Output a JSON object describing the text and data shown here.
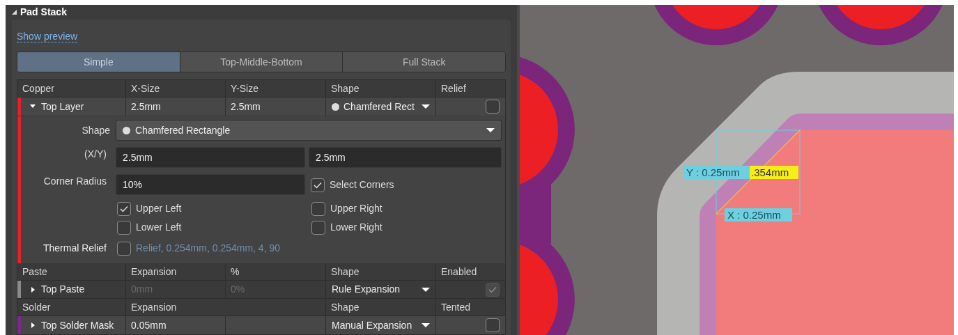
{
  "panel": {
    "title": "Pad Stack",
    "expanded": true
  },
  "preview_link": "Show preview",
  "tabs": [
    {
      "label": "Simple",
      "selected": true
    },
    {
      "label": "Top-Middle-Bottom",
      "selected": false
    },
    {
      "label": "Full Stack",
      "selected": false
    }
  ],
  "copper": {
    "columns": [
      "Copper",
      "X-Size",
      "Y-Size",
      "Shape",
      "Relief"
    ],
    "row": {
      "layer": "Top Layer",
      "color": "#e8202a",
      "expanded": true,
      "x_size": "2.5mm",
      "y_size": "2.5mm",
      "shape": "Chamfered Rect",
      "relief": false
    }
  },
  "details": {
    "shape_label": "Shape",
    "shape": "Chamfered Rectangle",
    "xy_label": "(X/Y)",
    "x": "2.5mm",
    "y": "2.5mm",
    "corner_radius_label": "Corner Radius",
    "corner_radius": "10%",
    "select_corners": {
      "label": "Select Corners",
      "checked": true
    },
    "corners": [
      {
        "label": "Upper Left",
        "checked": true
      },
      {
        "label": "Upper Right",
        "checked": false
      },
      {
        "label": "Lower Left",
        "checked": false
      },
      {
        "label": "Lower Right",
        "checked": false
      }
    ],
    "thermal_relief_label": "Thermal Relief",
    "thermal_relief": {
      "checked": false,
      "text": "Relief, 0.254mm, 0.254mm, 4, 90"
    }
  },
  "paste": {
    "columns": [
      "Paste",
      "Expansion",
      "%",
      "Shape",
      "Enabled"
    ],
    "row": {
      "layer": "Top Paste",
      "color": "#8a8a8a",
      "expanded": false,
      "expansion": "0mm",
      "percent": "0%",
      "disabled": true,
      "shape": "Rule Expansion",
      "enabled": true
    }
  },
  "solder": {
    "columns": [
      "Solder",
      "Expansion",
      "Shape",
      "Tented"
    ],
    "row": {
      "layer": "Top Solder Mask",
      "color": "#7b2a8a",
      "expanded": false,
      "expansion": "0.05mm",
      "shape": "Manual Expansion",
      "tented": false
    }
  },
  "canvas": {
    "measurements": [
      {
        "kind": "y",
        "text": "Y : 0.25mm"
      },
      {
        "kind": "diagonal",
        "text": ".354mm"
      },
      {
        "kind": "x",
        "text": "X : 0.25mm"
      }
    ]
  }
}
